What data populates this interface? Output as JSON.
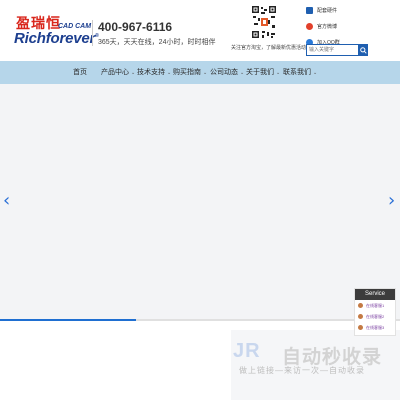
{
  "header": {
    "logo_cn": "盈瑞恒",
    "logo_badge": "CAD CAM",
    "logo_en": "Richforever",
    "logo_reg": "®",
    "phone": "400-967-6116",
    "service_hours": "365天，天天在线，24小时，时时相伴",
    "qr_caption": "关注官方淘宝，了解最新优惠活动",
    "links": [
      {
        "label": "配套硬件",
        "icon": "hardware-icon",
        "color": "#1f5fb0"
      },
      {
        "label": "官方微博",
        "icon": "weibo-icon",
        "color": "#e2402b"
      },
      {
        "label": "加入QQ群",
        "icon": "qq-icon",
        "color": "#2b7ad8"
      }
    ],
    "search_placeholder": "输入关键字"
  },
  "nav": {
    "items": [
      {
        "label": "首页",
        "has_menu": false
      },
      {
        "label": "产品中心",
        "has_menu": true
      },
      {
        "label": "技术支持",
        "has_menu": true
      },
      {
        "label": "购买指南",
        "has_menu": true
      },
      {
        "label": "公司动态",
        "has_menu": true
      },
      {
        "label": "关于我们",
        "has_menu": true
      },
      {
        "label": "联系我们",
        "has_menu": true
      }
    ]
  },
  "banner": {
    "prev": "‹",
    "next": "›",
    "progress": 0.34
  },
  "service": {
    "title": "Service",
    "rows": [
      "在线客服1",
      "在线客服2",
      "在线客服3"
    ]
  },
  "watermark": {
    "logo": "JR",
    "title": "自动秒收录",
    "subtitle": "做上链接—来访一次—自动收录"
  },
  "colors": {
    "brand_red": "#d9261c",
    "brand_blue": "#1d3f8f",
    "nav_bg": "#b6d6ea",
    "accent": "#1f6fd1"
  }
}
